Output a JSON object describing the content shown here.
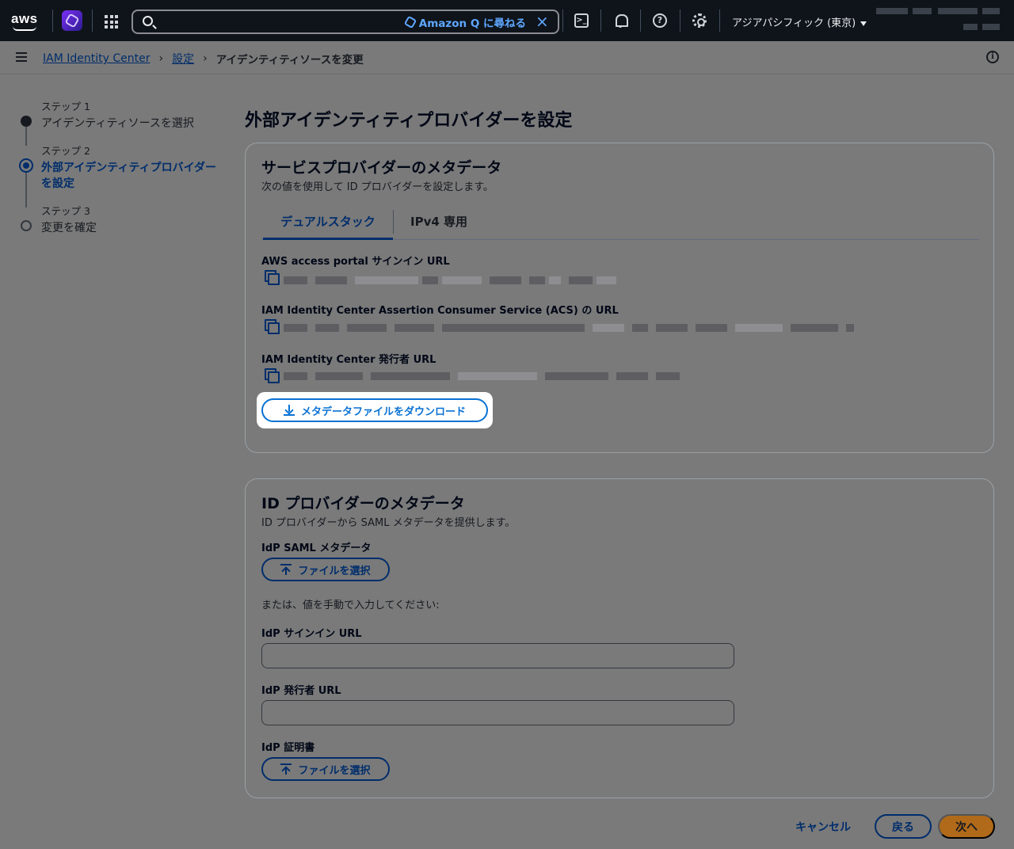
{
  "topnav": {
    "logo": "aws",
    "search_q_label": "Amazon Q に尋ねる",
    "region": "アジアパシフィック (東京)",
    "icons": [
      "amazon-q-icon",
      "app-grid-icon",
      "search-icon",
      "close-icon",
      "cloudshell-icon",
      "bell-icon",
      "help-icon",
      "gear-icon"
    ]
  },
  "breadcrumb": {
    "items": [
      "IAM Identity Center",
      "設定",
      "アイデンティティソースを変更"
    ]
  },
  "steps": [
    {
      "number": "ステップ 1",
      "label": "アイデンティティソースを選択",
      "state": "complete"
    },
    {
      "number": "ステップ 2",
      "label": "外部アイデンティティプロバイダーを設定",
      "state": "active"
    },
    {
      "number": "ステップ 3",
      "label": "変更を確定",
      "state": "pending"
    }
  ],
  "page_title": "外部アイデンティティプロバイダーを設定",
  "sp_metadata": {
    "title": "サービスプロバイダーのメタデータ",
    "description": "次の値を使用して ID プロバイダーを設定します。",
    "tabs": [
      "デュアルスタック",
      "IPv4 専用"
    ],
    "active_tab": 0,
    "fields": [
      {
        "label": "AWS access portal サインイン URL"
      },
      {
        "label": "IAM Identity Center Assertion Consumer Service (ACS) の URL"
      },
      {
        "label": "IAM Identity Center 発行者 URL"
      }
    ],
    "download_label": "メタデータファイルをダウンロード"
  },
  "idp_metadata": {
    "title": "ID プロバイダーのメタデータ",
    "description": "ID プロバイダーから SAML メタデータを提供します。",
    "saml_label": "IdP SAML メタデータ",
    "choose_file_label": "ファイルを選択",
    "manual_text": "または、値を手動で入力してください:",
    "signin_url_label": "IdP サインイン URL",
    "signin_url_value": "",
    "issuer_url_label": "IdP 発行者 URL",
    "issuer_url_value": "",
    "cert_label": "IdP 証明書",
    "cert_choose_label": "ファイルを選択"
  },
  "actions": {
    "cancel": "キャンセル",
    "back": "戻る",
    "next": "次へ"
  },
  "colors": {
    "topnav_bg": "#0f141a",
    "link": "#002d6b",
    "primary_button": "#b06a1a",
    "highlight_button": "#0972d3"
  }
}
